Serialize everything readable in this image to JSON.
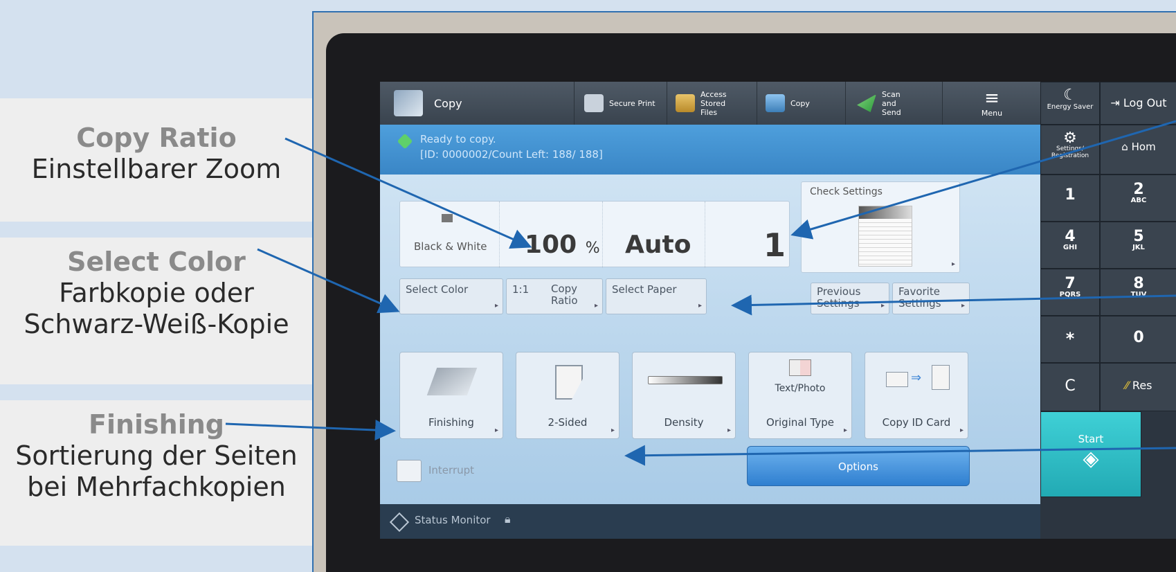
{
  "annotations": [
    {
      "title": "Copy Ratio",
      "desc": [
        "Einstellbarer Zoom"
      ]
    },
    {
      "title": "Select Color",
      "desc": [
        "Farbkopie oder",
        "Schwarz-Weiß-Kopie"
      ]
    },
    {
      "title": "Finishing",
      "desc": [
        "Sortierung der Seiten",
        "bei Mehrfachkopien"
      ]
    }
  ],
  "topbar": {
    "app_title": "Copy",
    "items": [
      "Secure Print",
      "Access Stored Files",
      "Copy",
      "Scan and Send",
      "Menu"
    ]
  },
  "right_panel": {
    "energy_saver": "Energy Saver",
    "log_out": "Log Out",
    "settings": "Settings/ Registration",
    "home": "Hom",
    "keys": [
      {
        "num": "1",
        "sub": ""
      },
      {
        "num": "2",
        "sub": "ABC"
      },
      {
        "num": "4",
        "sub": "GHI"
      },
      {
        "num": "5",
        "sub": "JKL"
      },
      {
        "num": "7",
        "sub": "PQRS"
      },
      {
        "num": "8",
        "sub": "TUV"
      },
      {
        "num": "*",
        "sub": ""
      },
      {
        "num": "0",
        "sub": ""
      }
    ],
    "clear": "C",
    "reset": "Res",
    "start": "Start"
  },
  "status": {
    "line1": "Ready to copy.",
    "line2": "[ID: 0000002/Count Left:  188/  188]"
  },
  "copy_settings": {
    "color_mode": "Black & White",
    "ratio_value": "100",
    "ratio_unit": "%",
    "paper": "Auto",
    "copies": "1",
    "check_settings": "Check Settings"
  },
  "buttons": {
    "select_color": "Select Color",
    "ratio_1_1": "1:1",
    "copy_ratio": "Copy Ratio",
    "select_paper": "Select Paper",
    "previous_settings": "Previous Settings",
    "favorite_settings": "Favorite Settings"
  },
  "functions": [
    "Finishing",
    "2-Sided",
    "Density",
    "Original Type",
    "Copy ID Card"
  ],
  "text_photo": "Text/Photo",
  "interrupt": "Interrupt",
  "options": "Options",
  "status_monitor": "Status Monitor",
  "colors": {
    "accent": "#1f66b0",
    "start": "#2bbfc8",
    "status_bar": "#3a86c6"
  }
}
